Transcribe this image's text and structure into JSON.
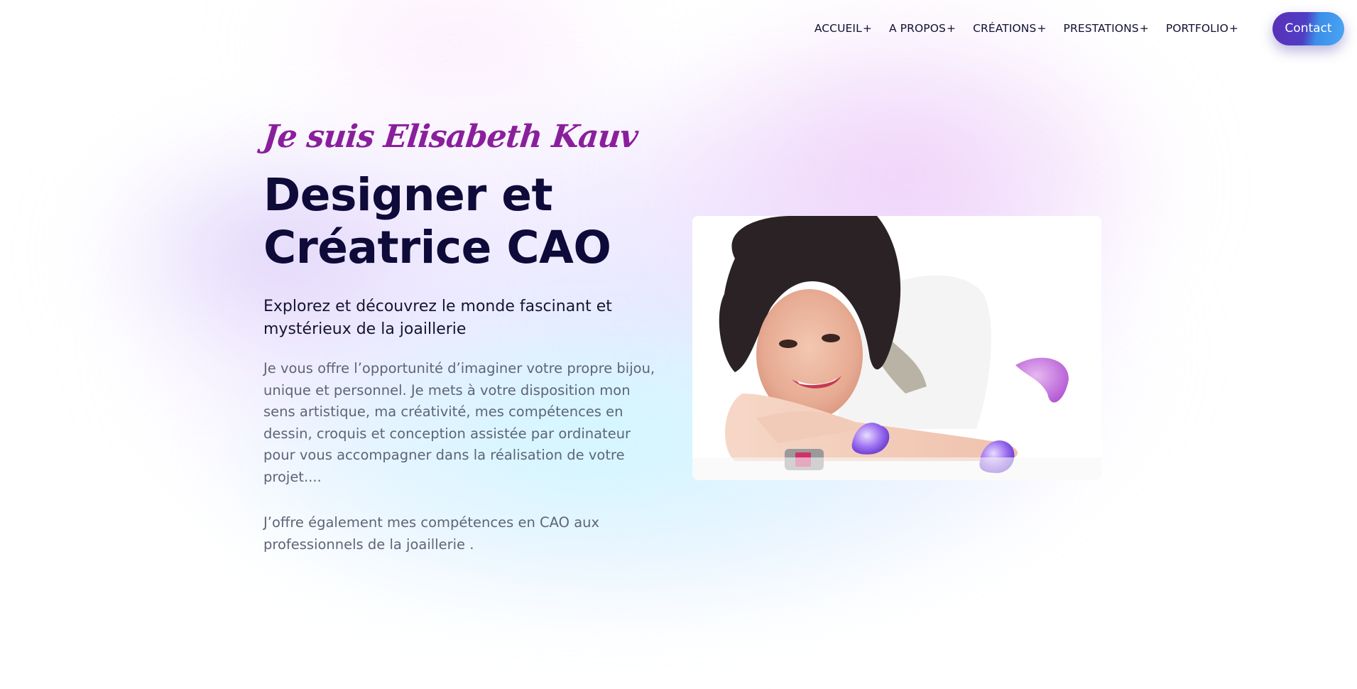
{
  "nav": {
    "items": [
      {
        "label": "ACCUEIL",
        "suffix": "+"
      },
      {
        "label": "A PROPOS",
        "suffix": "+"
      },
      {
        "label": "CRÉATIONS",
        "suffix": "+"
      },
      {
        "label": "PRESTATIONS",
        "suffix": "+"
      },
      {
        "label": "PORTFOLIO",
        "suffix": "+"
      }
    ],
    "contact_label": "Contact"
  },
  "hero": {
    "kicker": "Je suis Elisabeth Kauv",
    "title_line1": "Designer et",
    "title_line2": "Créatrice CAO",
    "subtitle": "Explorez et découvrez le monde fascinant et mystérieux de la joaillerie",
    "paragraph1": "Je vous offre l’opportunité d’imaginer votre propre bijou, unique et personnel. Je mets à votre disposition mon sens artistique, ma créativité, mes compétences en dessin, croquis et conception assistée par ordinateur pour vous accompagner dans la réalisation de votre projet....",
    "paragraph2": "J’offre également mes compétences en CAO aux professionnels de la joaillerie ."
  },
  "colors": {
    "accent_purple": "#8a1f9c",
    "heading_navy": "#0e0b3a",
    "body_gray": "#5e6478",
    "button_gradient_start": "#5a2fb8",
    "button_gradient_end": "#4aa6f2"
  }
}
